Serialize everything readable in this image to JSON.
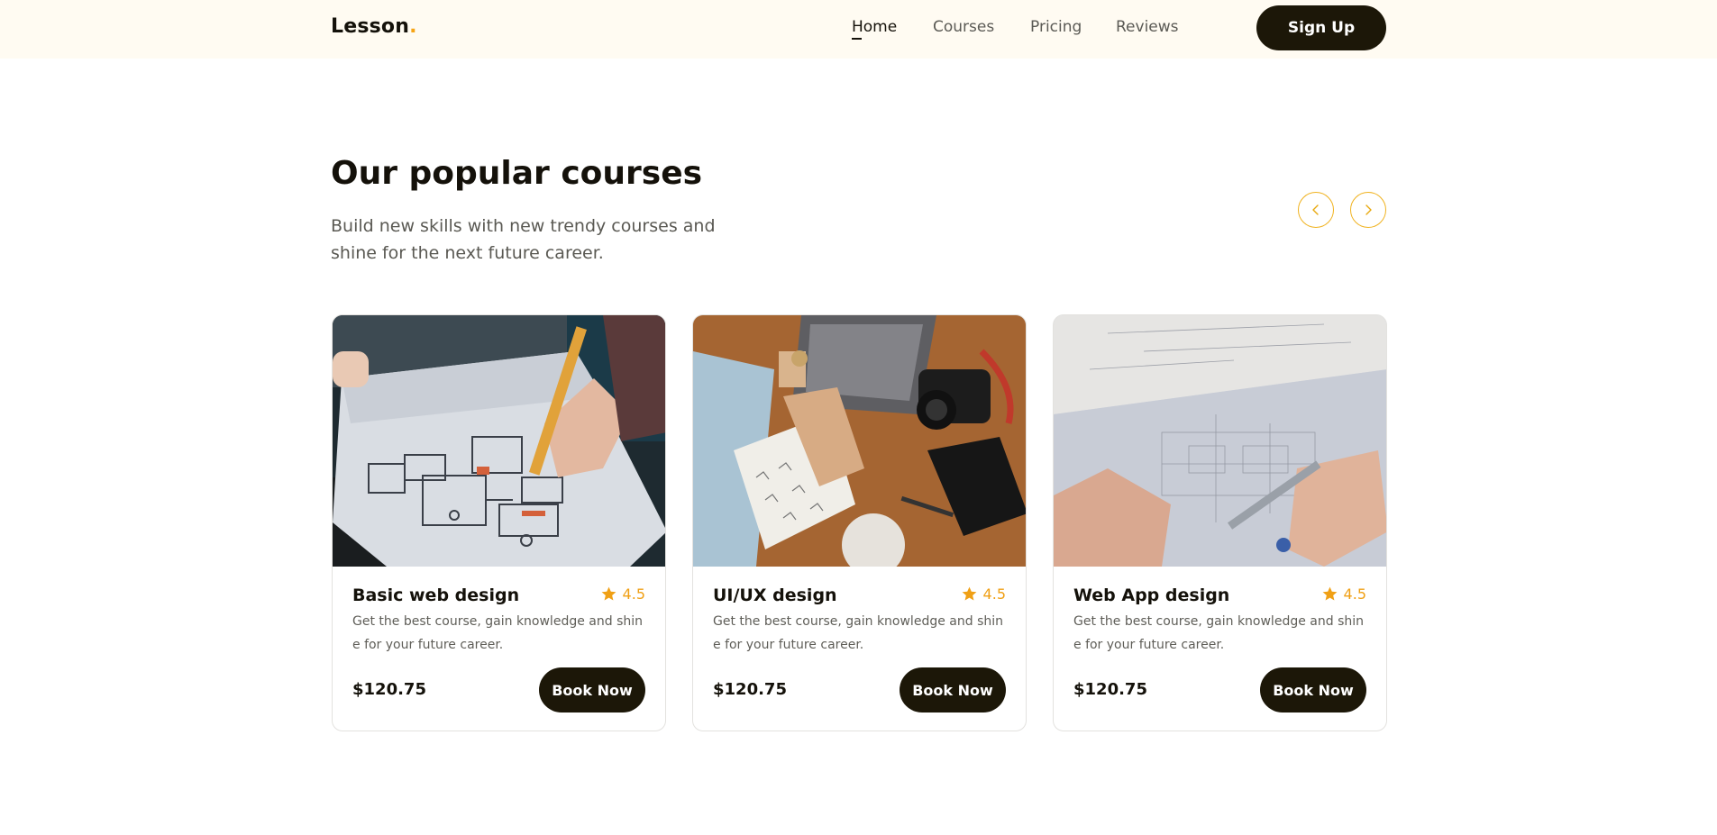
{
  "header": {
    "logo_text": "Lesson",
    "logo_dot": ".",
    "nav": [
      {
        "label": "Home",
        "active": true
      },
      {
        "label": "Courses",
        "active": false
      },
      {
        "label": "Pricing",
        "active": false
      },
      {
        "label": "Reviews",
        "active": false
      }
    ],
    "signup_label": "Sign Up"
  },
  "section": {
    "title": "Our popular courses",
    "subtitle": "Build new skills with new trendy courses and shine for the next future career."
  },
  "carousel": {
    "prev_icon": "chevron-left-icon",
    "next_icon": "chevron-right-icon"
  },
  "courses": [
    {
      "image": "sketching-wireframe-photo",
      "title": "Basic web design",
      "rating": "4.5",
      "description": "Get the best course, gain knowledge and shine for your future career.",
      "price": "$120.75",
      "button": "Book Now"
    },
    {
      "image": "desk-camera-notebook-photo",
      "title": "UI/UX design",
      "rating": "4.5",
      "description": "Get the best course, gain knowledge and shine for your future career.",
      "price": "$120.75",
      "button": "Book Now"
    },
    {
      "image": "blueprint-drawing-photo",
      "title": "Web App design",
      "rating": "4.5",
      "description": "Get the best course, gain knowledge and shine for your future career.",
      "price": "$120.75",
      "button": "Book Now"
    }
  ],
  "colors": {
    "accent": "#f0a015",
    "dark": "#1c1708",
    "header_bg": "#fffbf2"
  }
}
